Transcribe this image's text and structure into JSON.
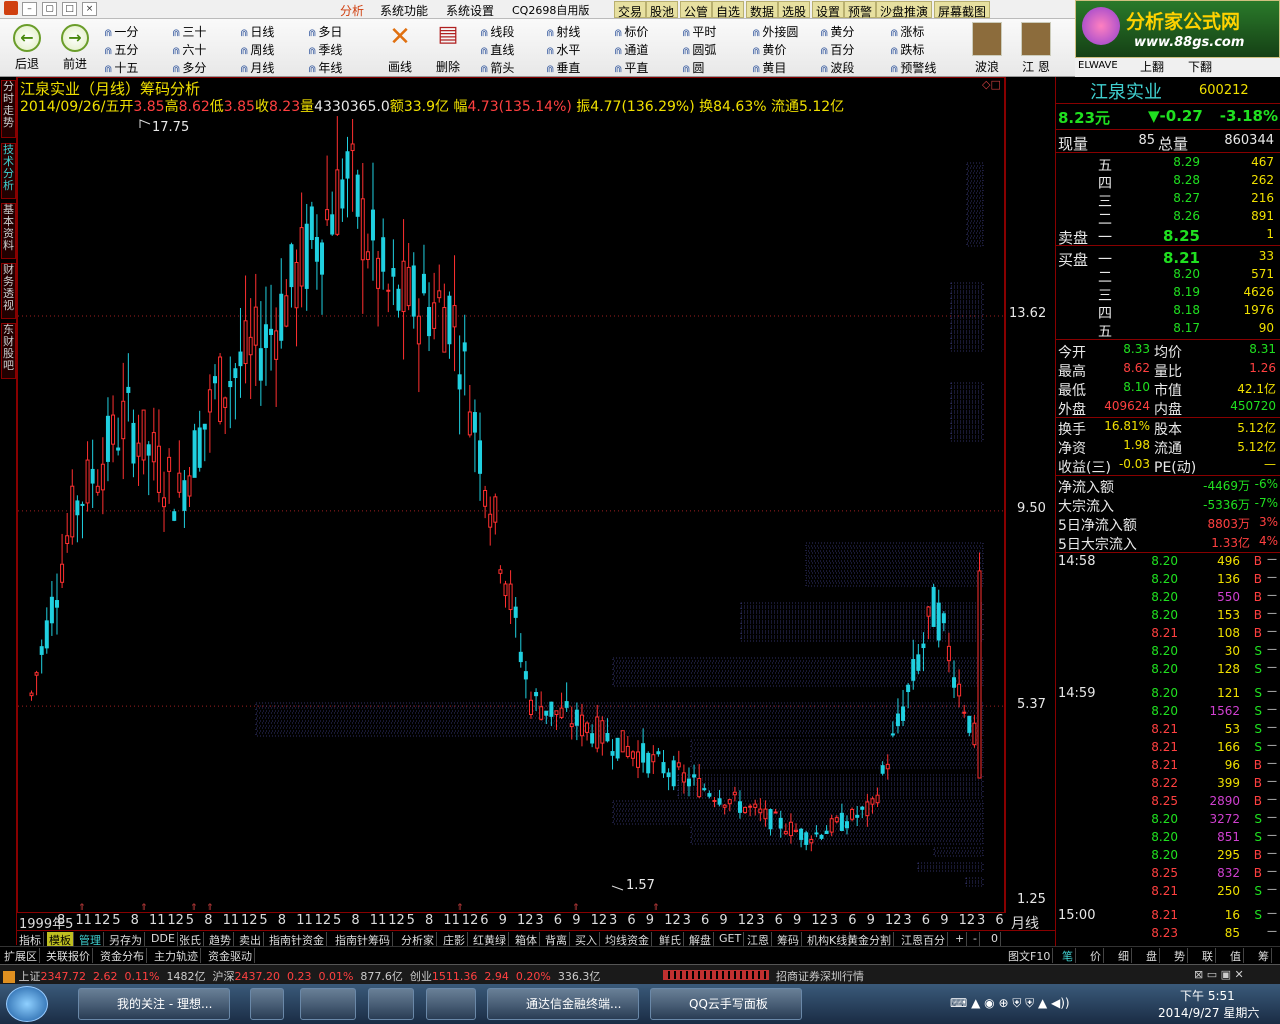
{
  "menubar": {
    "analyze": "分析",
    "sysfunc": "系统功能",
    "syssettings": "系统设置",
    "version": "CQ2698自用版",
    "tabs": [
      "交易",
      "股池",
      "公管",
      "自选",
      "数据",
      "选股",
      "设置",
      "预警",
      "沙盘推演",
      "屏幕截图"
    ]
  },
  "toolbar": {
    "back": "后退",
    "forward": "前进",
    "periods": [
      [
        "一分",
        "三十",
        "日线",
        "多日"
      ],
      [
        "五分",
        "六十",
        "周线",
        "季线"
      ],
      [
        "十五",
        "多分",
        "月线",
        "年线"
      ]
    ],
    "draw1": [
      "线段",
      "射线",
      "标价",
      "平时",
      "外接圆",
      "黄分",
      "涨标"
    ],
    "draw2": [
      "直线",
      "水平",
      "通道",
      "圆弧",
      "黄价",
      "百分",
      "跌标"
    ],
    "draw3": [
      "箭头",
      "垂直",
      "平直",
      "圆",
      "黄目",
      "波段",
      "预警线"
    ],
    "draw": "画线",
    "delete": "删除",
    "wave": "波浪",
    "jiangen": "江  恩",
    "elwave": "ELWAVE",
    "pgup": "上翻",
    "pgdn": "下翻"
  },
  "logo": {
    "title": "分析家公式网",
    "url": "www.88gs.com"
  },
  "sidetabs": [
    "分时走势",
    "技术分析",
    "基本资料",
    "财务透视",
    "东财股吧"
  ],
  "chart": {
    "title": "江泉实业（月线）筹码分析",
    "info": {
      "date": "2014/09/26/五",
      "open_l": "开",
      "open": "3.85",
      "high_l": "高",
      "high": "8.62",
      "low_l": "低",
      "low": "3.85",
      "close_l": "收",
      "close": "8.23",
      "vol_l": "量",
      "vol": "4330365.0",
      "amt_l": "额",
      "amt": "33.9亿",
      "rng_l": "幅",
      "rng": "4.73(135.14%)",
      "amp_l": "振",
      "amp": "4.77(136.29%)",
      "turn_l": "换",
      "turn": "84.63%",
      "flt_l": "流通",
      "flt": "5.12亿"
    },
    "max_label": "17.75",
    "min_label": "1.57",
    "axis": [
      "13.62",
      "9.50",
      "5.37",
      "1.25"
    ],
    "xaxis": [
      "1999年5",
      "8",
      "11",
      "12",
      "5",
      "8",
      "11",
      "12",
      "5",
      "8",
      "11",
      "12",
      "5",
      "8",
      "11",
      "12",
      "5",
      "8",
      "11",
      "12",
      "5",
      "8",
      "11",
      "12",
      "6",
      "9",
      "12",
      "3",
      "6",
      "9",
      "12",
      "3",
      "6",
      "9",
      "12",
      "3",
      "6",
      "9",
      "12",
      "3",
      "6",
      "9",
      "12",
      "3",
      "6",
      "9",
      "12",
      "3",
      "6",
      "9",
      "12",
      "3",
      "6"
    ],
    "period": "月线"
  },
  "chart_data": {
    "type": "candlestick",
    "title": "江泉实业（月线）筹码分析",
    "y_axis_ticks": [
      13.62,
      9.5,
      5.37,
      1.25
    ],
    "max": 17.75,
    "min": 1.57,
    "last": {
      "date": "2014/09/26",
      "open": 3.85,
      "high": 8.62,
      "low": 3.85,
      "close": 8.23
    }
  },
  "tabs1": [
    "指标",
    "模板",
    "管理",
    "另存为",
    "DDE",
    "张氏",
    "趋势",
    "卖出",
    "指南针资金",
    "指南针筹码",
    "分析家",
    "庄影",
    "红黄绿",
    "箱体",
    "背离",
    "买入",
    "均线资金",
    "鲜氏",
    "解盘",
    "GET",
    "江恩",
    "筹码",
    "机构K线",
    "黄金分割",
    "江恩百分",
    "+",
    "-",
    "0"
  ],
  "tabs2": [
    "扩展区",
    "关联报价",
    "资金分布",
    "主力轨迹",
    "资金驱动"
  ],
  "tabs2r": [
    "图文F10",
    "笔",
    "价",
    "细",
    "盘",
    "势",
    "联",
    "值",
    "筹"
  ],
  "status": {
    "sh_l": "上证",
    "sh": "2347.72",
    "sh_c": "2.62",
    "sh_p": "0.11%",
    "sh_a": "1482亿",
    "hs_l": "沪深",
    "hs": "2437.20",
    "hs_c": "0.23",
    "hs_p": "0.01%",
    "hs_a": "877.6亿",
    "cy_l": "创业",
    "cy": "1511.36",
    "cy_c": "2.94",
    "cy_p": "0.20%",
    "cy_a": "336.3亿",
    "broker": "招商证券深圳行情"
  },
  "taskbar": {
    "tasks": [
      "我的关注 - 理想...",
      "通达信金融终端...",
      "QQ云手写面板"
    ],
    "time": "下午 5:51",
    "date": "2014/9/27 星期六"
  },
  "quote": {
    "name": "江泉实业",
    "code": "600212",
    "price": "8.23元",
    "chg": "▼-0.27",
    "pct": "-3.18%",
    "now_l": "现量",
    "now": "85",
    "tot_l": "总量",
    "tot": "860344",
    "ask_l": "卖盘",
    "bid_l": "买盘",
    "asks": [
      [
        "五",
        "8.29",
        "467"
      ],
      [
        "四",
        "8.28",
        "262"
      ],
      [
        "三",
        "8.27",
        "216"
      ],
      [
        "二",
        "8.26",
        "891"
      ],
      [
        "一",
        "8.25",
        "1"
      ]
    ],
    "bids": [
      [
        "一",
        "8.21",
        "33"
      ],
      [
        "二",
        "8.20",
        "571"
      ],
      [
        "三",
        "8.19",
        "4626"
      ],
      [
        "四",
        "8.18",
        "1976"
      ],
      [
        "五",
        "8.17",
        "90"
      ]
    ],
    "stats": [
      [
        "今开",
        "8.33",
        "均价",
        "8.31"
      ],
      [
        "最高",
        "8.62",
        "量比",
        "1.26"
      ],
      [
        "最低",
        "8.10",
        "市值",
        "42.1亿"
      ],
      [
        "外盘",
        "409624",
        "内盘",
        "450720"
      ]
    ],
    "stats2": [
      [
        "换手",
        "16.81%",
        "股本",
        "5.12亿"
      ],
      [
        "净资",
        "1.98",
        "流通",
        "5.12亿"
      ],
      [
        "收益(三)",
        "-0.03",
        "PE(动)",
        "—"
      ]
    ],
    "flow": [
      [
        "净流入额",
        "-4469万",
        "-6%"
      ],
      [
        "大宗流入",
        "-5336万",
        "-7%"
      ],
      [
        "5日净流入额",
        "8803万",
        "3%"
      ],
      [
        "5日大宗流入",
        "1.33亿",
        "4%"
      ]
    ],
    "ticks": [
      [
        "14:58",
        "8.20",
        "496",
        "B"
      ],
      [
        "",
        "8.20",
        "136",
        "B"
      ],
      [
        "",
        "8.20",
        "550",
        "B"
      ],
      [
        "",
        "8.20",
        "153",
        "B"
      ],
      [
        "",
        "8.21",
        "108",
        "B"
      ],
      [
        "",
        "8.20",
        "30",
        "S"
      ],
      [
        "",
        "8.20",
        "128",
        "S"
      ],
      [
        "14:59",
        "8.20",
        "121",
        "S"
      ],
      [
        "",
        "8.20",
        "1562",
        "S"
      ],
      [
        "",
        "8.21",
        "53",
        "S"
      ],
      [
        "",
        "8.21",
        "166",
        "S"
      ],
      [
        "",
        "8.21",
        "96",
        "B"
      ],
      [
        "",
        "8.22",
        "399",
        "B"
      ],
      [
        "",
        "8.25",
        "2890",
        "B"
      ],
      [
        "",
        "8.20",
        "3272",
        "S"
      ],
      [
        "",
        "8.20",
        "851",
        "S"
      ],
      [
        "",
        "8.20",
        "295",
        "B"
      ],
      [
        "",
        "8.25",
        "832",
        "B"
      ],
      [
        "",
        "8.21",
        "250",
        "S"
      ],
      [
        "15:00",
        "8.21",
        "16",
        "S"
      ],
      [
        "",
        "8.23",
        "85",
        ""
      ]
    ]
  }
}
